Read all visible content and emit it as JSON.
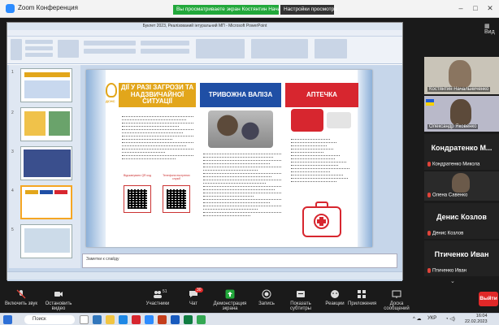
{
  "window": {
    "title": "Zoom Конференция",
    "view_label": "Вид"
  },
  "banners": {
    "sharing": "Вы просматриваете экран Костянтин Начальниченко",
    "view_options": "Настройки просмотра"
  },
  "ppt": {
    "title": "Буклет 2023, Реалізований інтуральний МП - Microsoft PowerPoint",
    "notes_placeholder": "Заметки к слайду"
  },
  "slide": {
    "logo_text": "ДСНС",
    "header1": "ДІЇ У РАЗІ ЗАГРОЗИ ТА НАДЗВИЧАЙНОЇ СИТУАЦІЇ",
    "header2": "ТРИВОЖНА ВАЛІЗА",
    "header3": "АПТЕЧКА",
    "qr1_label": "Відсканувати QR код",
    "qr2_label": "Телефони екстрених служб"
  },
  "participants": {
    "tile1_name": "Костянтин Начальниченко",
    "tile2_name": "Олександр Яковенко",
    "tile3_title": "Кондратенко М...",
    "tile3_name": "Кондратенко Микола",
    "tile4_name": "Олена Савенко",
    "tile5_title": "Денис Козлов",
    "tile5_name": "Денис Козлов",
    "tile6_title": "Птиченко Иван",
    "tile6_name": "Птиченко Иван"
  },
  "toolbar": {
    "mic": "Включить звук",
    "video": "Остановить видео",
    "participants": "Участники",
    "participants_count": "51",
    "chat": "Чат",
    "chat_badge": "30",
    "share": "Демонстрация экрана",
    "record": "Запись",
    "captions": "Показать субтитры",
    "reactions": "Реакции",
    "apps": "Приложения",
    "whiteboard": "Доска сообщений",
    "leave": "Выйти"
  },
  "taskbar": {
    "search": "Поиск",
    "lang": "УКР",
    "time": "16:04",
    "date": "22.02.2023"
  },
  "colors": {
    "zoom_blue": "#2d8cff",
    "share_green": "#22a83b",
    "leave_red": "#e02828",
    "slide_yellow": "#e2a61b",
    "slide_blue": "#1f4fa5",
    "slide_red": "#d7262f"
  }
}
